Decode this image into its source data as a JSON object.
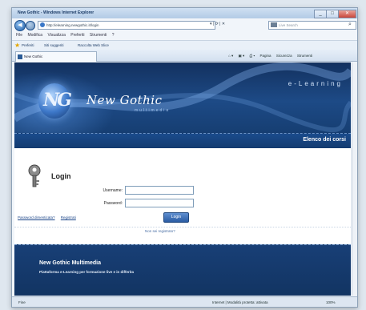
{
  "browser": {
    "title": "New Gothic - Windows Internet Explorer",
    "url": "http://elearning.newgothic.it/login",
    "search_placeholder": "Live Search",
    "menu": [
      "File",
      "Modifica",
      "Visualizza",
      "Preferiti",
      "Strumenti",
      "?"
    ],
    "favorites_label": "Preferiti",
    "favorites_items": [
      "Siti suggeriti",
      "Raccolta Web Slice"
    ],
    "tab_title": "New Gothic",
    "commands": [
      "Pagina",
      "Sicurezza",
      "Strumenti"
    ],
    "status_text": "Fine",
    "zone_text": "Internet | Modalità protetta: attivata",
    "zoom": "100%"
  },
  "site": {
    "brand": "New Gothic",
    "brand_sub": "multimedia",
    "tagline": "e-Learning",
    "courses_link": "Elenco dei corsi",
    "login_title": "Login",
    "username_label": "Username:",
    "password_label": "Password:",
    "forgot_password": "Password dimenticata?",
    "register": "Registrati",
    "login_button": "Login",
    "register_hint": "Non sei registrato?",
    "footer_title": "New Gothic Multimedia",
    "footer_subtitle": "Piattaforma e-Learning per formazione live e in differita"
  }
}
